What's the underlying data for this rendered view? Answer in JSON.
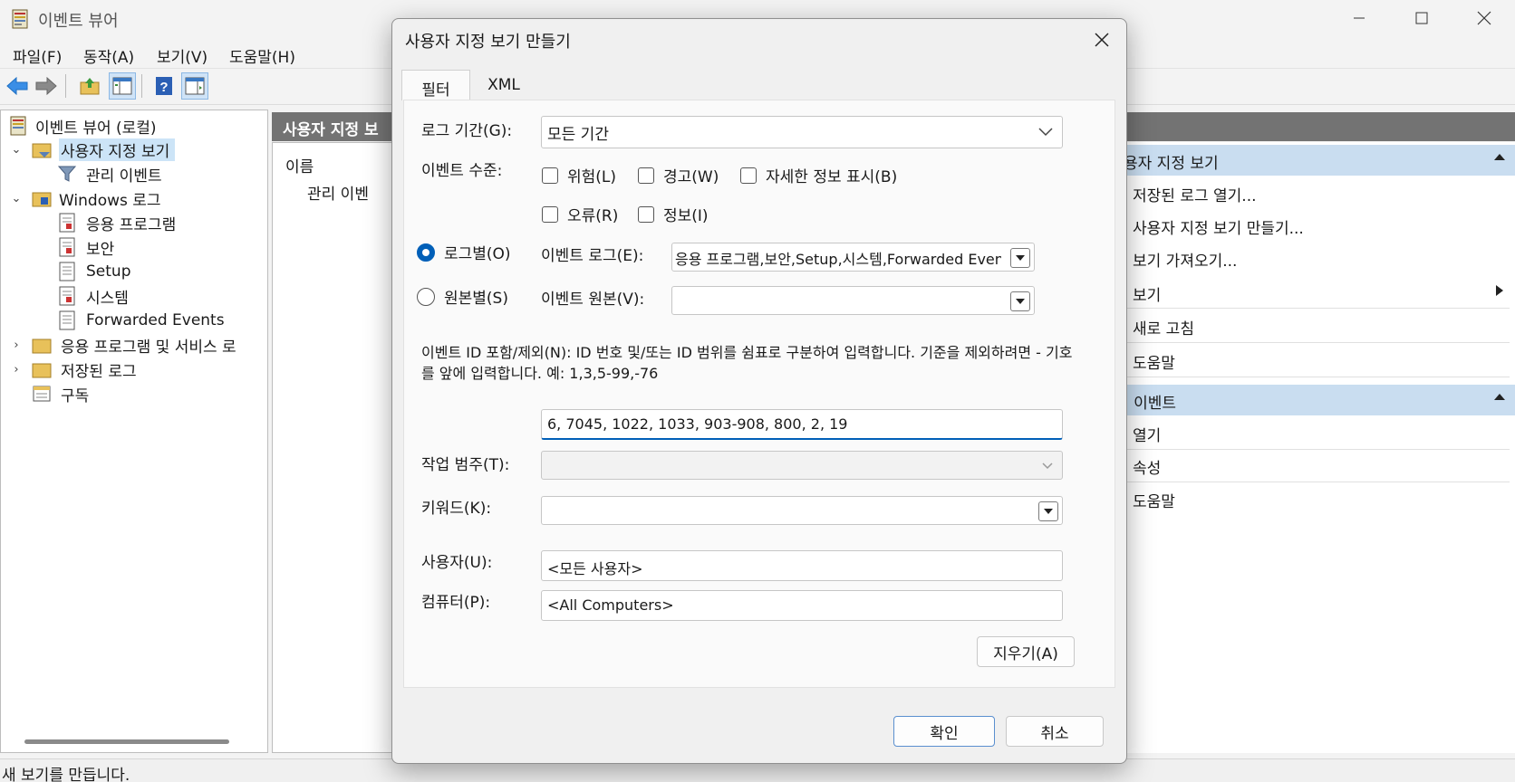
{
  "window": {
    "title": "이벤트 뷰어"
  },
  "menu": [
    "파일(F)",
    "동작(A)",
    "보기(V)",
    "도움말(H)"
  ],
  "tree": {
    "root": "이벤트 뷰어 (로컬)",
    "custom_views": "사용자 지정 보기",
    "admin_events": "관리 이벤트",
    "windows_logs": "Windows 로그",
    "application": "응용 프로그램",
    "security": "보안",
    "setup": "Setup",
    "system": "시스템",
    "forwarded": "Forwarded Events",
    "app_services": "응용 프로그램 및 서비스 로",
    "saved_logs": "저장된 로그",
    "subscriptions": "구독"
  },
  "middle": {
    "header": "사용자 지정 보",
    "column_name": "이름",
    "row1": "관리 이벤"
  },
  "actions": {
    "section1_header": "용자 지정 보기",
    "open_saved": "저장된 로그 열기...",
    "create_custom": "사용자 지정 보기 만들기...",
    "import_view": "보기 가져오기...",
    "view": "보기",
    "refresh": "새로 고침",
    "help1": "도움말",
    "section2_header": "| 이벤트",
    "open": "열기",
    "properties": "속성",
    "help2": "도움말"
  },
  "status": "새 보기를 만듭니다.",
  "dialog": {
    "title": "사용자 지정 보기 만들기",
    "tabs": [
      "필터",
      "XML"
    ],
    "logged_label": "로그 기간(G):",
    "logged_value": "모든 기간",
    "level_label": "이벤트 수준:",
    "levels": [
      "위험(L)",
      "경고(W)",
      "자세한 정보 표시(B)",
      "오류(R)",
      "정보(I)"
    ],
    "by_log": "로그별(O)",
    "by_source": "원본별(S)",
    "event_logs_label": "이벤트 로그(E):",
    "event_logs_value": "응용 프로그램,보안,Setup,시스템,Forwarded Events",
    "event_sources_label": "이벤트 원본(V):",
    "event_sources_value": "",
    "id_desc": "이벤트 ID 포함/제외(N): ID 번호 및/또는 ID 범위를 쉼표로 구분하여 입력합니다. 기준을 제외하려면 - 기호를 앞에 입력합니다. 예: 1,3,5-99,-76",
    "id_value": "6, 7045, 1022, 1033, 903-908, 800, 2, 19",
    "task_label": "작업 범주(T):",
    "keywords_label": "키워드(K):",
    "user_label": "사용자(U):",
    "user_value": "<모든 사용자>",
    "computer_label": "컴퓨터(P):",
    "computer_value": "<All Computers>",
    "clear_button": "지우기(A)",
    "ok_button": "확인",
    "cancel_button": "취소"
  },
  "colors": {
    "accent": "#005fb8",
    "selection": "#cce4f7",
    "pane_header": "#737373",
    "action_header": "#c9ddf0"
  }
}
